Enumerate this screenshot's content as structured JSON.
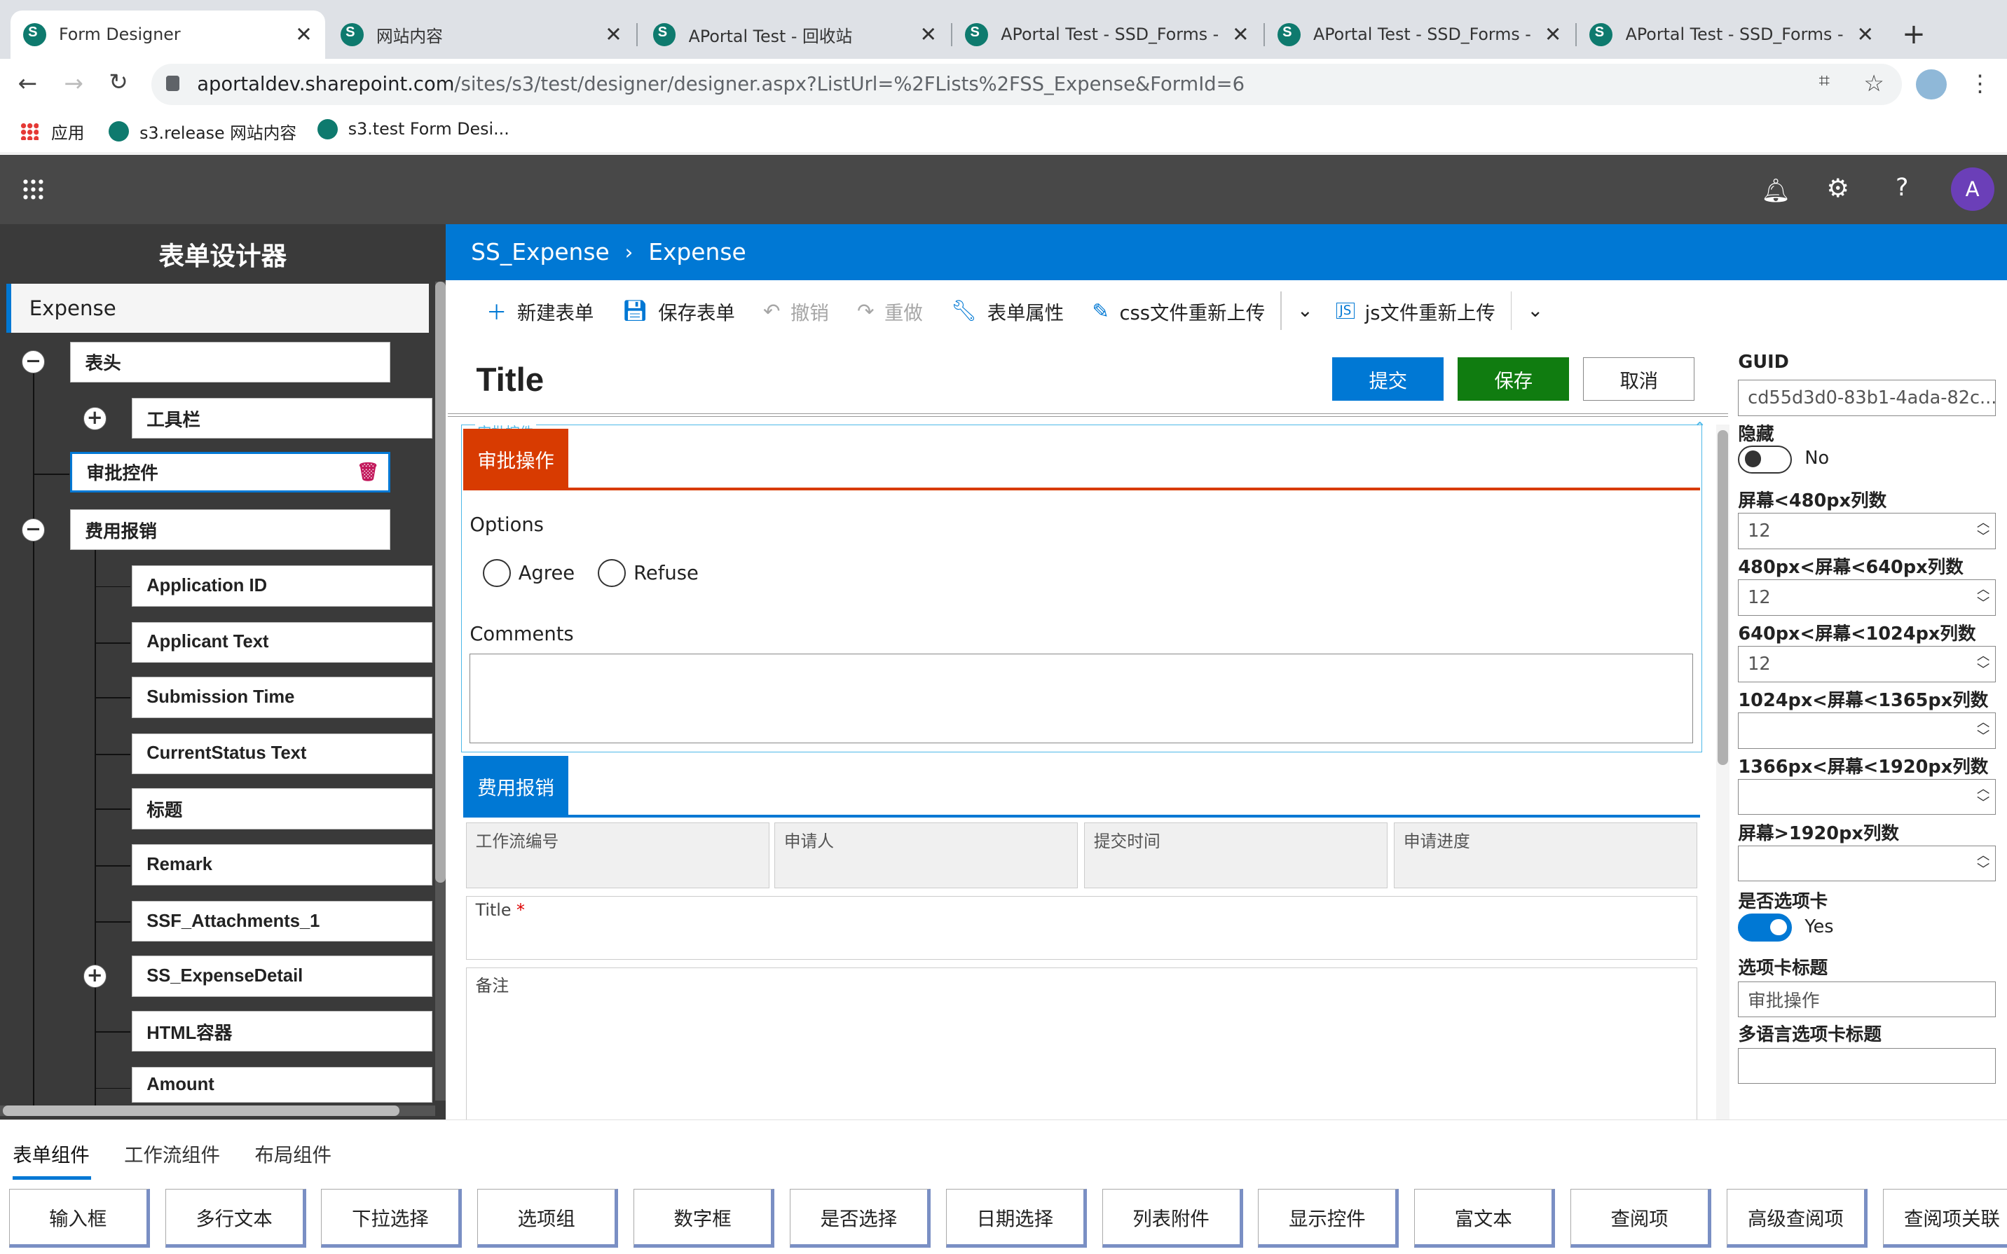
{
  "browser": {
    "tabs": [
      {
        "label": "Form Designer",
        "active": true
      },
      {
        "label": "网站内容"
      },
      {
        "label": "APortal Test - 回收站"
      },
      {
        "label": "APortal Test - SSD_Forms - "
      },
      {
        "label": "APortal Test - SSD_Forms - "
      },
      {
        "label": "APortal Test - SSD_Forms - "
      }
    ],
    "close_glyph": "✕",
    "new_tab_glyph": "+",
    "url_host": "aportaldev.sharepoint.com",
    "url_path": "/sites/s3/test/designer/designer.aspx?ListUrl=%2FLists%2FSS_Expense&FormId=6",
    "bookmarks": [
      "应用",
      "s3.release 网站内容",
      "s3.test Form Desi..."
    ]
  },
  "suite": {
    "avatar": "A"
  },
  "left_panel": {
    "title": "表单设计器",
    "root": "Expense",
    "nodes": {
      "header": "表头",
      "toolbar": "工具栏",
      "approval": "审批控件",
      "expense": "费用报销",
      "application_id": "Application ID",
      "applicant_text": "Applicant Text",
      "submission_time": "Submission Time",
      "current_status": "CurrentStatus Text",
      "title_cn": "标题",
      "remark": "Remark",
      "attachments": "SSF_Attachments_1",
      "expense_detail": "SS_ExpenseDetail",
      "html_container": "HTML容器",
      "amount": "Amount"
    }
  },
  "breadcrumb": {
    "site": "SS_Expense",
    "page": "Expense"
  },
  "commands": {
    "new_form": "新建表单",
    "save_form": "保存表单",
    "undo": "撤销",
    "redo": "重做",
    "form_props": "表单属性",
    "css_upload": "css文件重新上传",
    "js_upload": "js文件重新上传"
  },
  "form": {
    "title": "Title",
    "submit": "提交",
    "save": "保存",
    "cancel": "取消",
    "approval_tag": "审批控件",
    "approval_tab": "审批操作",
    "options_label": "Options",
    "agree": "Agree",
    "refuse": "Refuse",
    "comments_label": "Comments",
    "expense_tab": "费用报销",
    "ro_fields": [
      "工作流编号",
      "申请人",
      "提交时间",
      "申请进度"
    ],
    "title_field": "Title",
    "title_required": "*",
    "remark_field": "备注"
  },
  "properties": {
    "guid_label": "GUID",
    "guid_value": "cd55d3d0-83b1-4ada-82c...",
    "hidden_label": "隐藏",
    "hidden_value": "No",
    "col_lt480_label": "屏幕<480px列数",
    "col_lt480_value": "12",
    "col_480_640_label": "480px<屏幕<640px列数",
    "col_480_640_value": "12",
    "col_640_1024_label": "640px<屏幕<1024px列数",
    "col_640_1024_value": "12",
    "col_1024_1365_label": "1024px<屏幕<1365px列数",
    "col_1366_1920_label": "1366px<屏幕<1920px列数",
    "col_gt1920_label": "屏幕>1920px列数",
    "is_tab_label": "是否选项卡",
    "is_tab_value": "Yes",
    "tab_title_label": "选项卡标题",
    "tab_title_value": "审批操作",
    "ml_tab_title_label": "多语言选项卡标题"
  },
  "toolbox": {
    "tabs": [
      "表单组件",
      "工作流组件",
      "布局组件"
    ],
    "items": [
      "输入框",
      "多行文本",
      "下拉选择",
      "选项组",
      "数字框",
      "是否选择",
      "日期选择",
      "列表附件",
      "显示控件",
      "富文本",
      "查阅项",
      "高级查阅项",
      "查阅项关联"
    ]
  },
  "colors": {
    "accent": "#0078d4",
    "approval": "#d83b01",
    "save": "#107c10"
  }
}
